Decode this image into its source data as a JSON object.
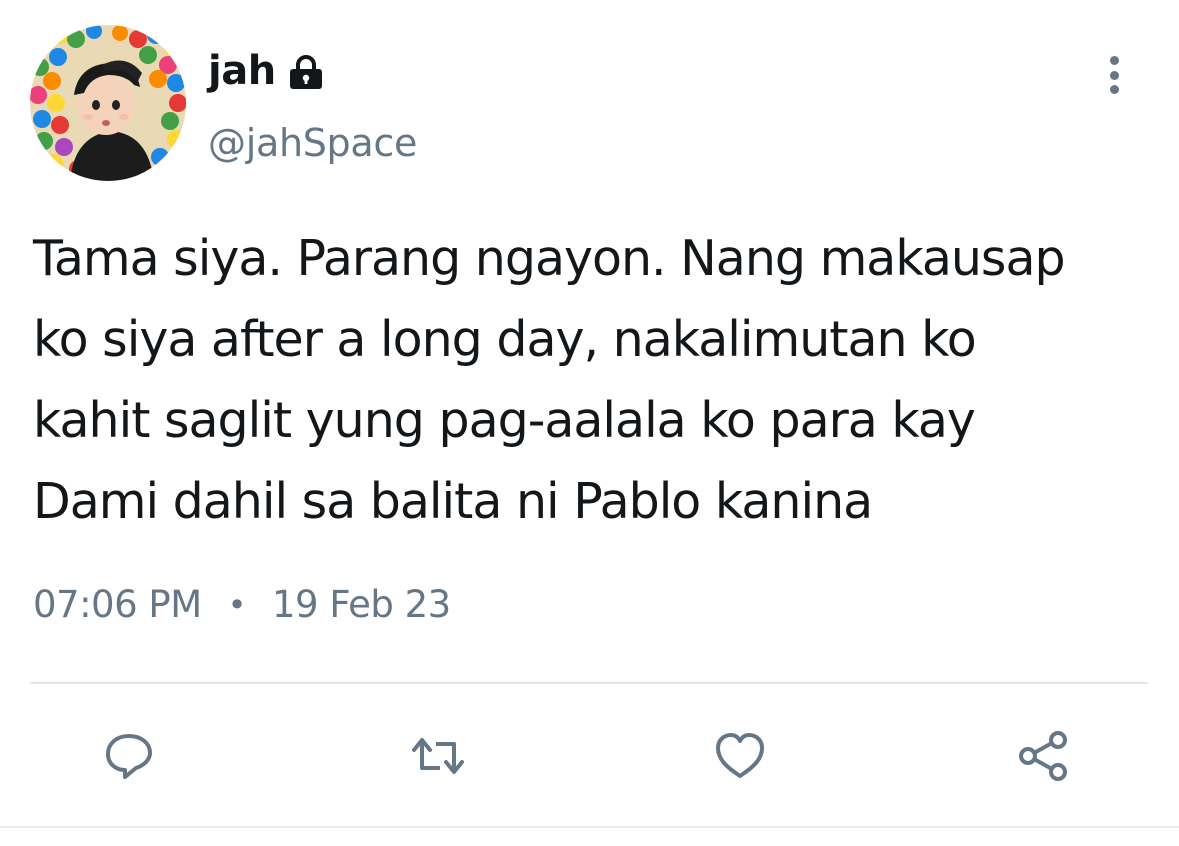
{
  "user": {
    "display_name": "jah",
    "handle": "@jahSpace",
    "protected_icon": "lock-icon",
    "avatar": "profile-photo"
  },
  "tweet": {
    "text": "Tama siya. Parang ngayon. Nang makausap\nko siya after a long day, nakalimutan ko\nkahit saglit yung pag-aalala ko para kay\nDami dahil sa balita ni Pablo kanina",
    "time": "07:06 PM",
    "separator": "•",
    "date": "19 Feb 23"
  },
  "actions": [
    {
      "name": "reply",
      "icon": "reply-icon"
    },
    {
      "name": "retweet",
      "icon": "retweet-icon"
    },
    {
      "name": "like",
      "icon": "heart-icon"
    },
    {
      "name": "share",
      "icon": "share-icon"
    }
  ],
  "more_menu_icon": "more-vertical-icon",
  "colors": {
    "text_primary": "#14171a",
    "text_secondary": "#657786",
    "divider": "#e1e8ed"
  }
}
